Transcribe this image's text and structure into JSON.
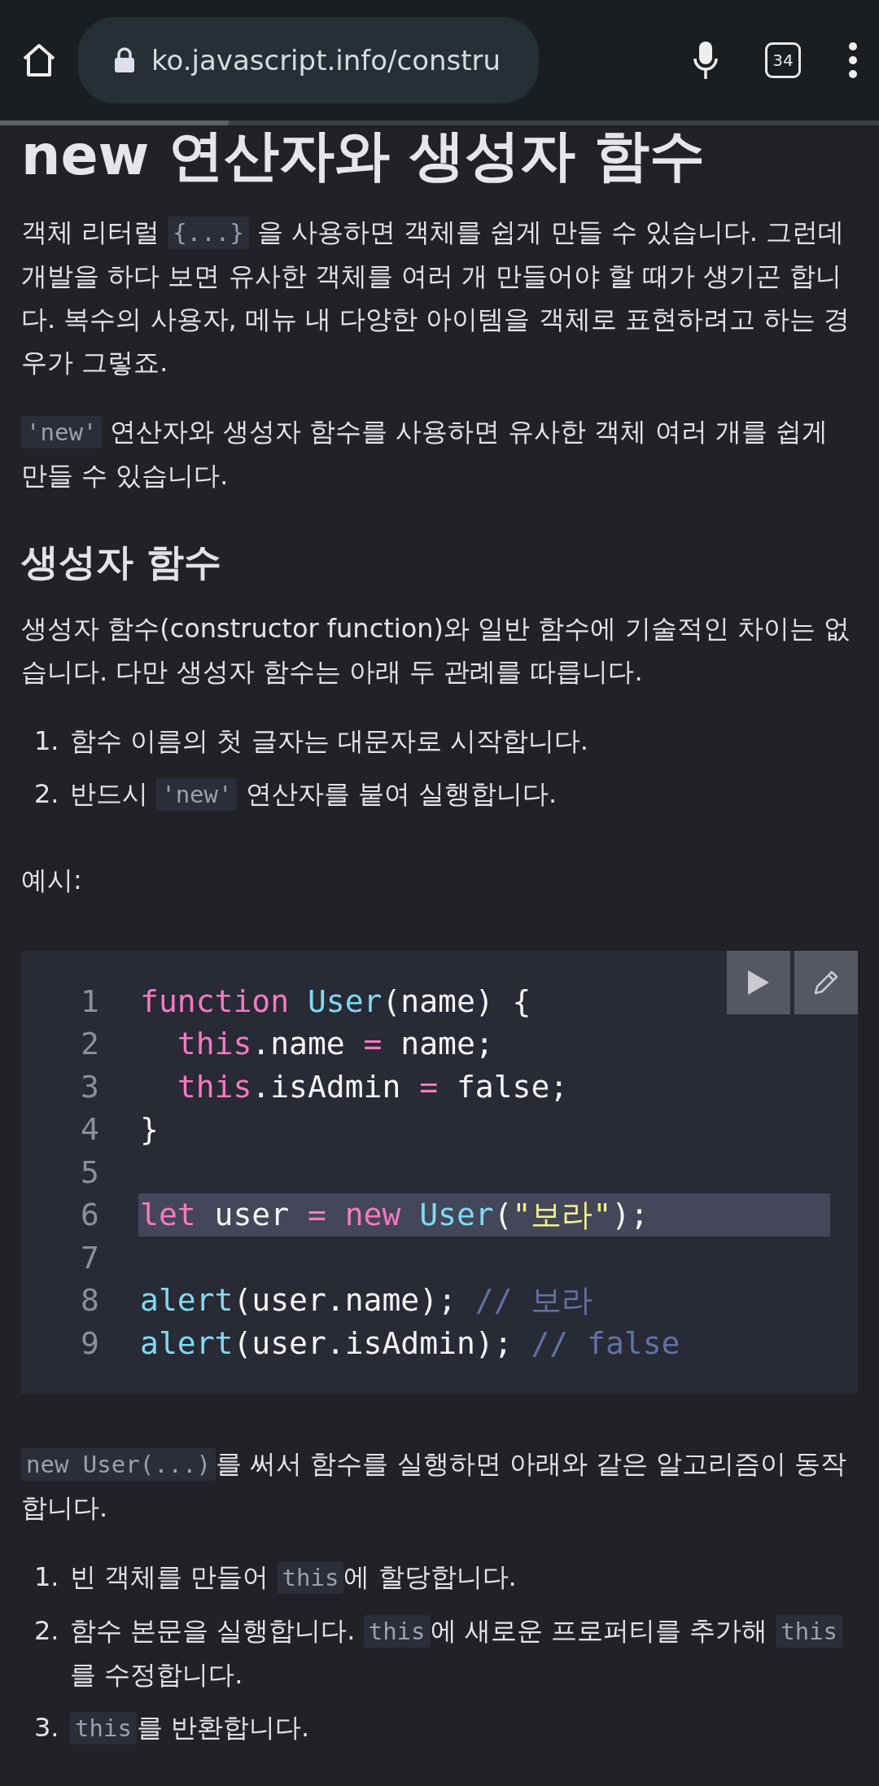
{
  "browser": {
    "url": "ko.javascript.info/constru",
    "tab_count": "34",
    "progress": {
      "level": 0.26
    }
  },
  "title": "new 연산자와 생성자 함수",
  "blocks": [
    {
      "kind": "p",
      "parts": [
        {
          "kind": "text",
          "text": "객체 리터럴 "
        },
        {
          "kind": "code",
          "text": "{...}"
        },
        {
          "kind": "text",
          "text": " 을 사용하면 객체를 쉽게 만들 수 있습니다. 그런데 개발을 하다 보면 유사한 객체를 여러 개 만들어야 할 때가 생기곤 합니다. 복수의 사용자, 메뉴 내 다양한 아이템을 객체로 표현하려고 하는 경우가 그렇죠."
        }
      ]
    },
    {
      "kind": "p",
      "parts": [
        {
          "kind": "code",
          "text": "'new'"
        },
        {
          "kind": "text",
          "text": " 연산자와 생성자 함수를 사용하면 유사한 객체 여러 개를 쉽게 만들 수 있습니다."
        }
      ]
    },
    {
      "kind": "h2",
      "text": "생성자 함수"
    },
    {
      "kind": "p",
      "parts": [
        {
          "kind": "text",
          "text": "생성자 함수(constructor function)와 일반 함수에 기술적인 차이는 없습니다. 다만 생성자 함수는 아래 두 관례를 따릅니다."
        }
      ]
    },
    {
      "kind": "ol",
      "items": [
        {
          "marker": "1.",
          "parts": [
            {
              "kind": "text",
              "text": "함수 이름의 첫 글자는 대문자로 시작합니다."
            }
          ]
        },
        {
          "marker": "2.",
          "parts": [
            {
              "kind": "text",
              "text": "반드시 "
            },
            {
              "kind": "code",
              "text": "'new'"
            },
            {
              "kind": "text",
              "text": " 연산자를 붙여 실행합니다."
            }
          ]
        }
      ]
    },
    {
      "kind": "p",
      "parts": [
        {
          "kind": "text",
          "text": "예시:"
        }
      ]
    },
    {
      "kind": "code",
      "lines": [
        {
          "number": "1",
          "highlighted": false,
          "tokens": [
            {
              "kind": "kw",
              "text": "function"
            },
            {
              "kind": "fn",
              "text": " User"
            },
            {
              "kind": "plain",
              "text": "(name) {"
            }
          ]
        },
        {
          "number": "2",
          "highlighted": false,
          "tokens": [
            {
              "kind": "kw",
              "text": "  this"
            },
            {
              "kind": "plain",
              "text": ".name "
            },
            {
              "kind": "kw",
              "text": "="
            },
            {
              "kind": "plain",
              "text": " name;"
            }
          ]
        },
        {
          "number": "3",
          "highlighted": false,
          "tokens": [
            {
              "kind": "kw",
              "text": "  this"
            },
            {
              "kind": "plain",
              "text": ".isAdmin "
            },
            {
              "kind": "kw",
              "text": "="
            },
            {
              "kind": "plain",
              "text": " false;"
            }
          ]
        },
        {
          "number": "4",
          "highlighted": false,
          "tokens": [
            {
              "kind": "plain",
              "text": "}"
            }
          ]
        },
        {
          "number": "5",
          "highlighted": false
        },
        {
          "number": "6",
          "highlighted": true,
          "tokens": [
            {
              "kind": "kw",
              "text": "let"
            },
            {
              "kind": "plain",
              "text": " user "
            },
            {
              "kind": "kw",
              "text": "="
            },
            {
              "kind": "kw",
              "text": " new"
            },
            {
              "kind": "fn",
              "text": " User"
            },
            {
              "kind": "plain",
              "text": "("
            },
            {
              "kind": "str",
              "text": "\"보라\""
            },
            {
              "kind": "plain",
              "text": ");"
            }
          ]
        },
        {
          "number": "7",
          "highlighted": false
        },
        {
          "number": "8",
          "highlighted": false,
          "tokens": [
            {
              "kind": "fn",
              "text": "alert"
            },
            {
              "kind": "plain",
              "text": "(user.name); "
            },
            {
              "kind": "comment",
              "text": "// 보라"
            }
          ]
        },
        {
          "number": "9",
          "highlighted": false,
          "tokens": [
            {
              "kind": "fn",
              "text": "alert"
            },
            {
              "kind": "plain",
              "text": "(user.isAdmin); "
            },
            {
              "kind": "comment",
              "text": "// false"
            }
          ]
        }
      ]
    },
    {
      "kind": "p",
      "parts": [
        {
          "kind": "code",
          "text": "new User(...)"
        },
        {
          "kind": "text",
          "text": "를 써서 함수를 실행하면 아래와 같은 알고리즘이 동작합니다."
        }
      ]
    },
    {
      "kind": "ol",
      "items": [
        {
          "marker": "1.",
          "parts": [
            {
              "kind": "text",
              "text": "빈 객체를 만들어 "
            },
            {
              "kind": "code",
              "text": "this"
            },
            {
              "kind": "text",
              "text": "에 할당합니다."
            }
          ]
        },
        {
          "marker": "2.",
          "parts": [
            {
              "kind": "text",
              "text": "함수 본문을 실행합니다. "
            },
            {
              "kind": "code",
              "text": "this"
            },
            {
              "kind": "text",
              "text": "에 새로운 프로퍼티를 추가해 "
            },
            {
              "kind": "code",
              "text": "this"
            },
            {
              "kind": "text",
              "text": "를 수정합니다."
            }
          ]
        },
        {
          "marker": "3.",
          "parts": [
            {
              "kind": "code",
              "text": "this"
            },
            {
              "kind": "text",
              "text": "를 반환합니다."
            }
          ]
        }
      ]
    }
  ]
}
